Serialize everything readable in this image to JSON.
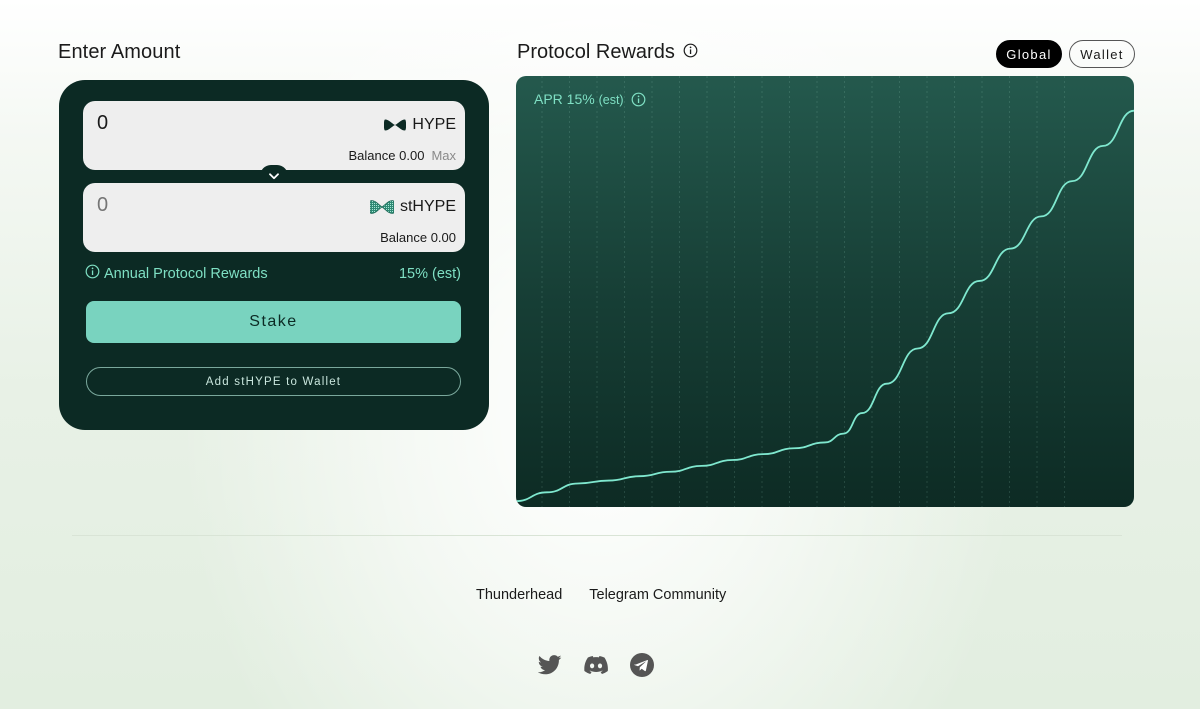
{
  "stake_panel": {
    "title": "Enter Amount",
    "from": {
      "amount_value": "0",
      "token_symbol": "HYPE",
      "balance_label": "Balance",
      "balance_value": "0.00",
      "max_label": "Max"
    },
    "to": {
      "amount_placeholder": "0",
      "token_symbol": "stHYPE",
      "balance_label": "Balance",
      "balance_value": "0.00"
    },
    "rewards_label": "Annual Protocol Rewards",
    "rewards_value": "15% (est)",
    "stake_button": "Stake",
    "add_wallet_button": "Add stHYPE to Wallet"
  },
  "rewards_panel": {
    "title": "Protocol Rewards",
    "toggle": [
      {
        "label": "Global",
        "active": true
      },
      {
        "label": "Wallet",
        "active": false
      }
    ],
    "apr_label": "APR 15%",
    "apr_est": "(est)"
  },
  "chart_data": {
    "type": "line",
    "title": "",
    "xlabel": "",
    "ylabel": "",
    "grid": "vertical dotted",
    "x": [
      0,
      5,
      10,
      15,
      20,
      25,
      30,
      35,
      40,
      45,
      50,
      53,
      56,
      60,
      65,
      70,
      75,
      80,
      85,
      90,
      95,
      100
    ],
    "series": [
      {
        "values": [
          2,
          5,
          8,
          9,
          10.5,
          12,
          14,
          16,
          18,
          20,
          22,
          25,
          32,
          42,
          54,
          66,
          77,
          88,
          99,
          111,
          123,
          135
        ],
        "color": "#7fe8cf"
      }
    ],
    "xlim": [
      0,
      100
    ],
    "ylim": [
      0,
      140
    ],
    "background_top": "#24594d",
    "background_bottom": "#0d2b24"
  },
  "footer": {
    "links": [
      "Thunderhead",
      "Telegram Community"
    ],
    "socials": [
      "twitter-icon",
      "discord-icon",
      "telegram-icon"
    ]
  },
  "colors": {
    "card_bg": "#0c2a24",
    "accent": "#79d3bf",
    "accent_text": "#7fe0c4"
  }
}
